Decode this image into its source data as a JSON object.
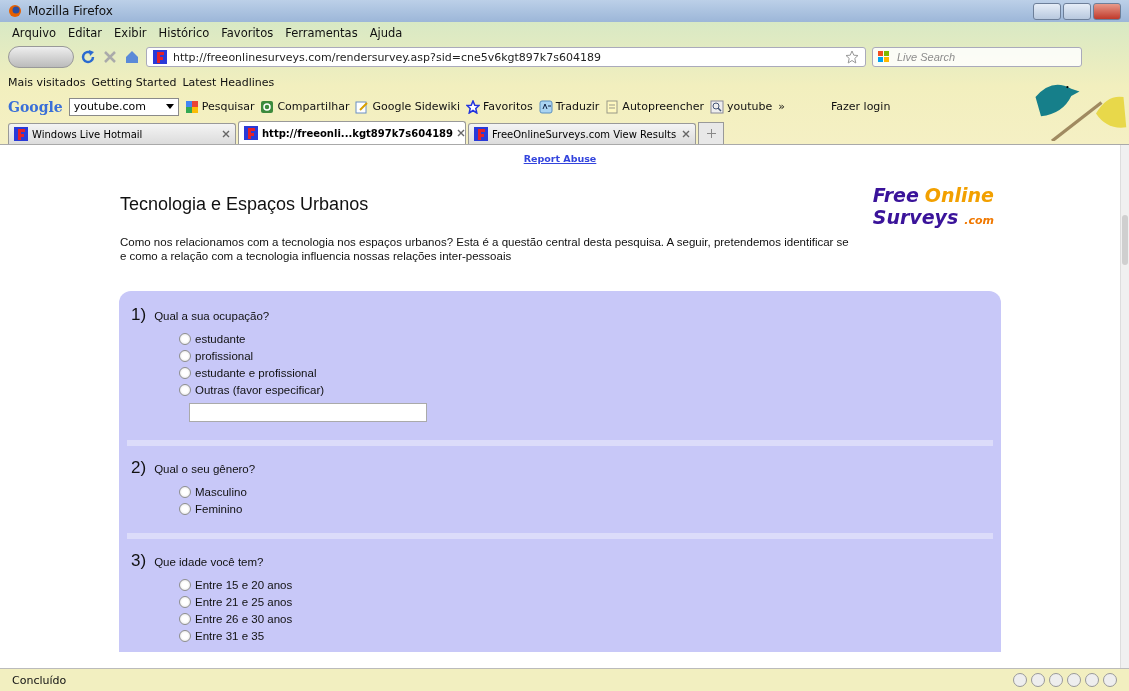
{
  "window": {
    "title": "Mozilla Firefox"
  },
  "menu": [
    "Arquivo",
    "Editar",
    "Exibir",
    "Histórico",
    "Favoritos",
    "Ferramentas",
    "Ajuda"
  ],
  "address": {
    "url": "http://freeonlinesurveys.com/rendersurvey.asp?sid=cne5v6kgt897k7s604189"
  },
  "search": {
    "placeholder": "Live Search"
  },
  "bookmarks": [
    "Mais visitados",
    "Getting Started",
    "Latest Headlines"
  ],
  "google_toolbar": {
    "brand": "Google",
    "query": "youtube.com",
    "items": [
      {
        "kind": "pesquisar",
        "label": "Pesquisar"
      },
      {
        "kind": "share",
        "label": "Compartilhar"
      },
      {
        "kind": "sidewiki",
        "label": "Google Sidewiki"
      },
      {
        "kind": "star",
        "label": "Favoritos"
      },
      {
        "kind": "translate",
        "label": "Traduzir"
      },
      {
        "kind": "autofill",
        "label": "Autopreencher"
      },
      {
        "kind": "find",
        "label": "youtube"
      }
    ],
    "more": "»",
    "login": "Fazer login"
  },
  "tabs": [
    {
      "label": "Windows Live Hotmail",
      "selected": false
    },
    {
      "label": "http://freeonli...kgt897k7s604189",
      "selected": true
    },
    {
      "label": "FreeOnlineSurveys.com View Results",
      "selected": false
    }
  ],
  "page": {
    "report_link": "Report Abuse",
    "title": "Tecnologia e Espaços Urbanos",
    "logo": {
      "line1": [
        "Free",
        "Online"
      ],
      "line2": [
        "Surveys",
        ".com"
      ]
    },
    "intro": "Como nos relacionamos com a tecnologia nos espaços urbanos? Esta é a questão central desta pesquisa. A seguir, pretendemos identificar se e como a relação com a tecnologia influencia nossas relações inter-pessoais",
    "questions": [
      {
        "number": "1)",
        "text": "Qual a sua ocupação?",
        "options": [
          {
            "kind": "radio",
            "label": "estudante",
            "selected": false
          },
          {
            "kind": "radio",
            "label": "profissional",
            "selected": false
          },
          {
            "kind": "radio",
            "label": "estudante e profissional",
            "selected": false
          },
          {
            "kind": "other",
            "label": "Outras (favor especificar)",
            "selected": false
          }
        ]
      },
      {
        "number": "2)",
        "text": "Qual o seu gênero?",
        "options": [
          {
            "kind": "radio",
            "label": "Masculino",
            "selected": false
          },
          {
            "kind": "radio",
            "label": "Feminino",
            "selected": false
          }
        ]
      },
      {
        "number": "3)",
        "text": "Que idade você tem?",
        "options": [
          {
            "kind": "radio",
            "label": "Entre 15 e 20 anos",
            "selected": false
          },
          {
            "kind": "radio",
            "label": "Entre 21 e 25 anos",
            "selected": false
          },
          {
            "kind": "radio",
            "label": "Entre 26 e 30 anos",
            "selected": false
          },
          {
            "kind": "radio",
            "label": "Entre 31 e 35",
            "selected": false
          }
        ]
      }
    ]
  },
  "status_bar": {
    "text": "Concluído"
  }
}
